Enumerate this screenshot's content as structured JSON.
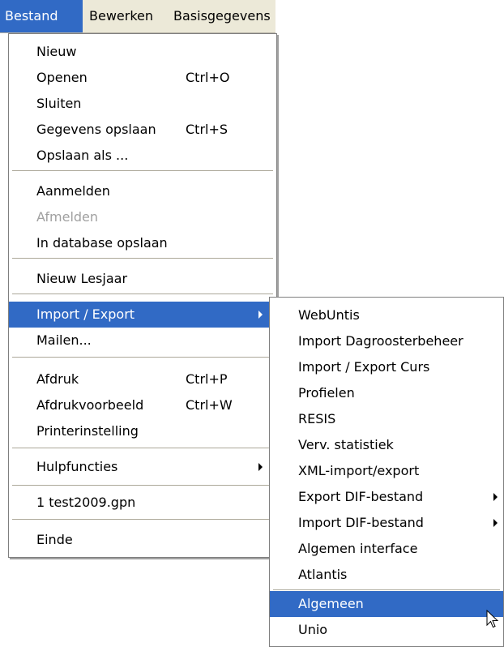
{
  "menubar": {
    "items": [
      "Bestand",
      "Bewerken",
      "Basisgegevens"
    ]
  },
  "bestand_menu": {
    "nieuw": "Nieuw",
    "openen": "Openen",
    "openen_shortcut": "Ctrl+O",
    "sluiten": "Sluiten",
    "gegevens_opslaan": "Gegevens opslaan",
    "gegevens_opslaan_shortcut": "Ctrl+S",
    "opslaan_als": "Opslaan als ...",
    "aanmelden": "Aanmelden",
    "afmelden": "Afmelden",
    "in_database_opslaan": "In database opslaan",
    "nieuw_lesjaar": "Nieuw Lesjaar",
    "import_export": "Import / Export",
    "mailen": "Mailen...",
    "afdruk": "Afdruk",
    "afdruk_shortcut": "Ctrl+P",
    "afdrukvoorbeeld": "Afdrukvoorbeeld",
    "afdrukvoorbeeld_shortcut": "Ctrl+W",
    "printerinstelling": "Printerinstelling",
    "hulpfuncties": "Hulpfuncties",
    "recent_file": "1 test2009.gpn",
    "einde": "Einde"
  },
  "import_export_menu": {
    "webuntis": "WebUntis",
    "import_dagroosterbeheer": "Import Dagroosterbeheer",
    "import_export_curs": "Import / Export Curs",
    "profielen": "Profielen",
    "resis": "RESIS",
    "verv_statistiek": "Verv. statistiek",
    "xml_import_export": "XML-import/export",
    "export_dif": "Export DIF-bestand",
    "import_dif": "Import DIF-bestand",
    "algemen_interface": "Algemen interface",
    "atlantis": "Atlantis",
    "algemeen": "Algemeen",
    "unio": "Unio"
  },
  "colors": {
    "highlight": "#316ac5",
    "menubar_bg": "#ece9d8",
    "disabled_text": "#a0a0a0"
  }
}
